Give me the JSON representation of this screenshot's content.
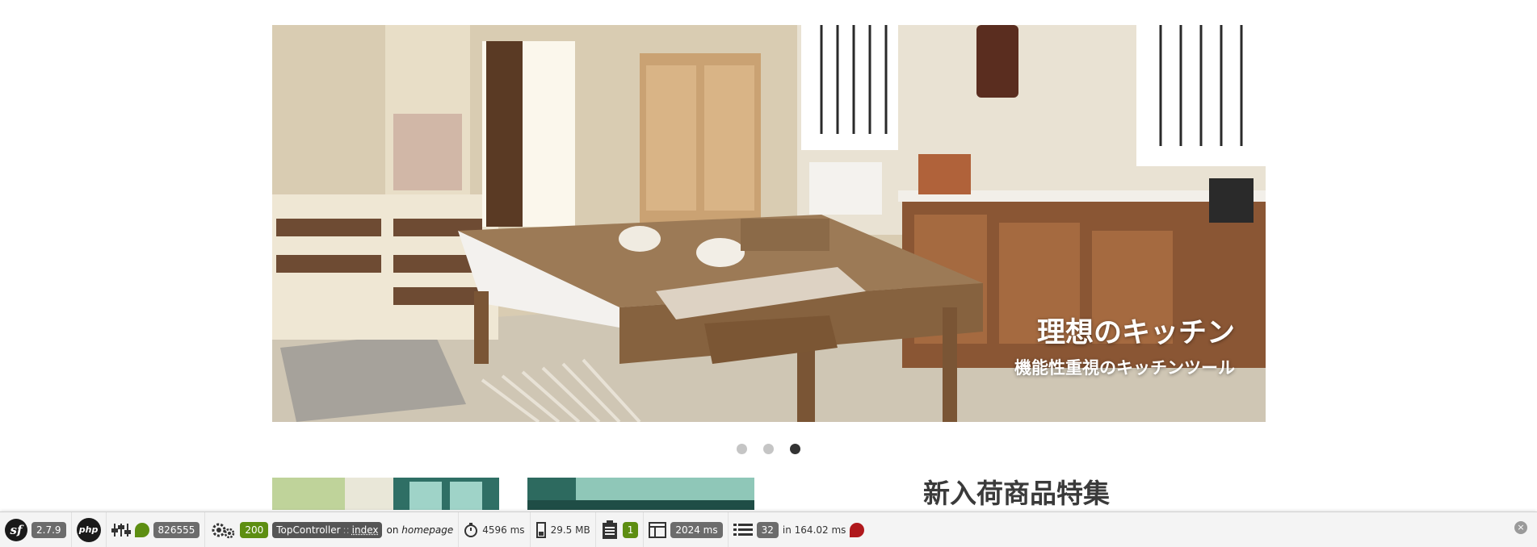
{
  "hero": {
    "title": "理想のキッチン",
    "subtitle": "機能性重視のキッチンツール",
    "slides": 3,
    "active_slide": 3
  },
  "section": {
    "title": "新入荷商品特集"
  },
  "debug_toolbar": {
    "symfony_version": "2.7.9",
    "php_label": "php",
    "environment_value": "826555",
    "status_code": "200",
    "controller": "TopController",
    "controller_sep": "::",
    "action": "index",
    "route_prefix": "on",
    "route_name": "homepage",
    "time": "4596 ms",
    "memory": "29.5 MB",
    "form_count": "1",
    "render_time": "2024 ms",
    "query_count": "32",
    "query_time": "in 164.02 ms",
    "close_symbol": "×"
  },
  "colors": {
    "toolbar_bg": "#f4f4f4",
    "badge_green": "#5d8e12",
    "badge_gray": "#6c6c6c",
    "status_red": "#b0181c",
    "dot_active": "#333333",
    "dot_inactive": "#c5c5c5"
  }
}
